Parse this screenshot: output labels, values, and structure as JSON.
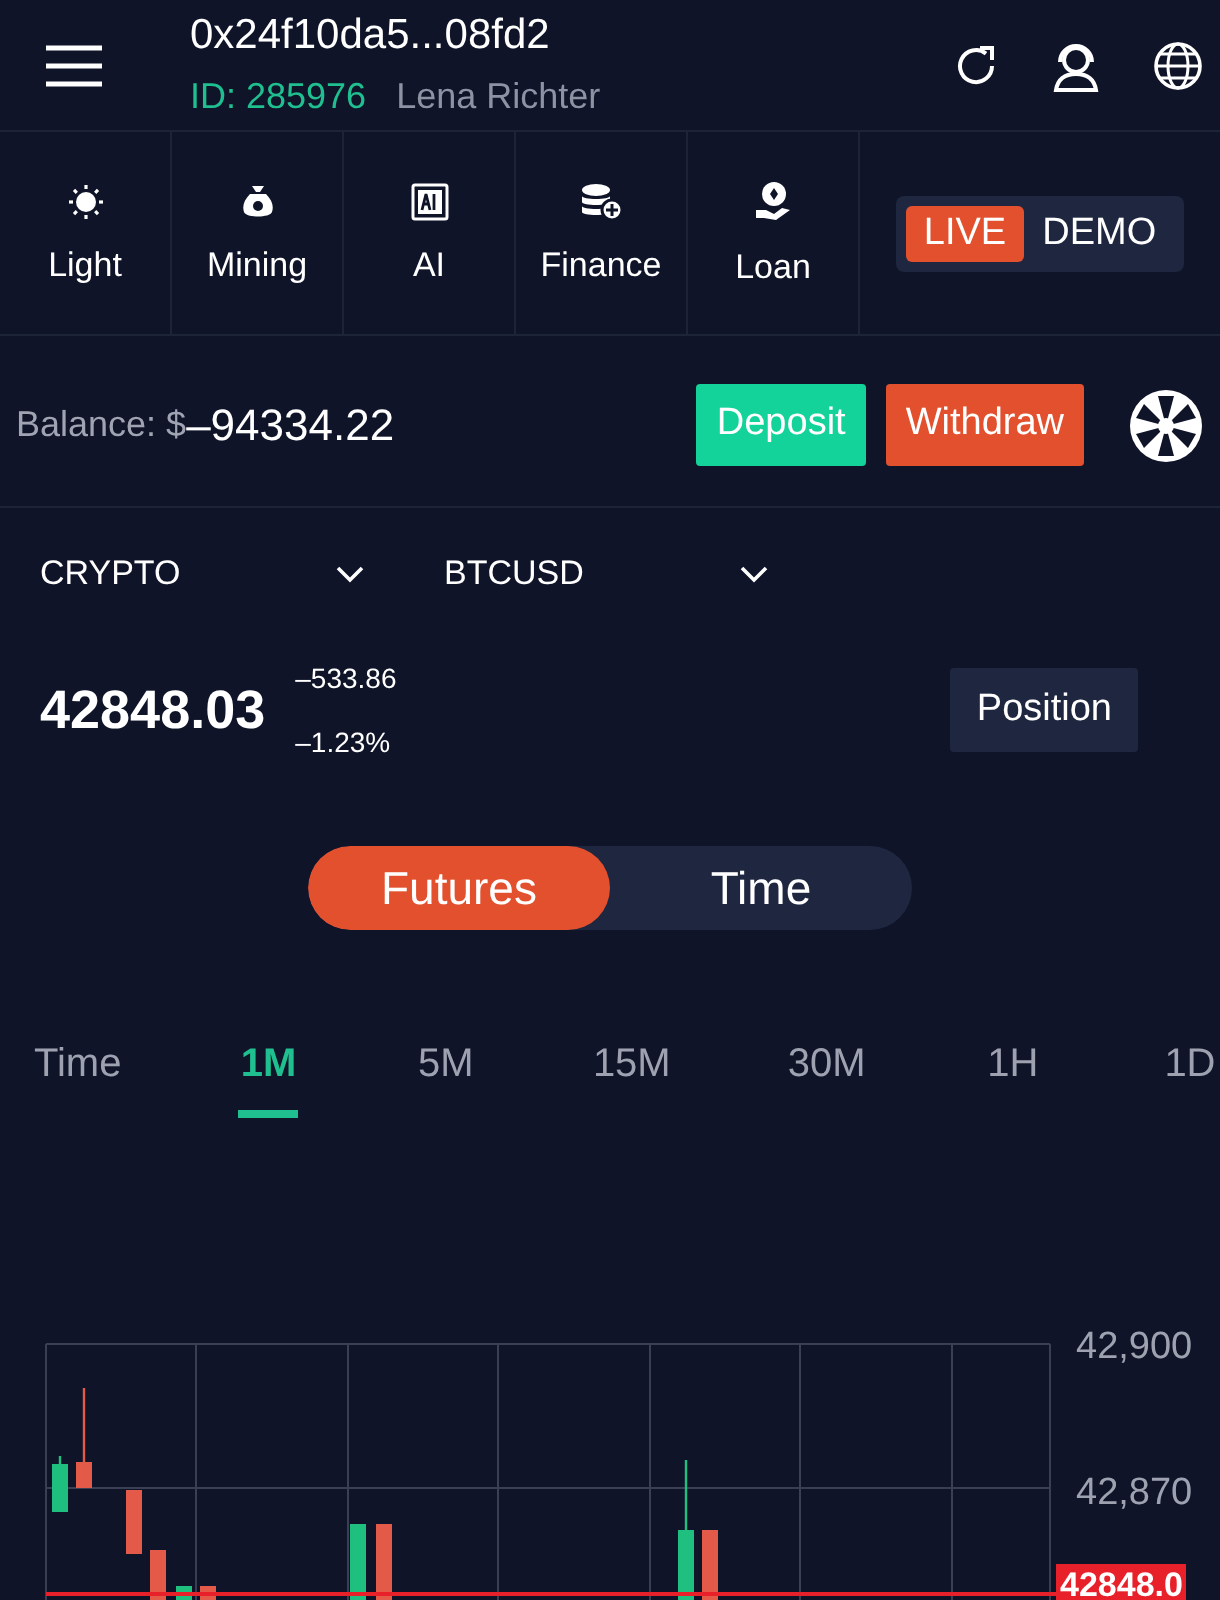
{
  "header": {
    "address": "0x24f10da5...08fd2",
    "user_id": "ID: 285976",
    "user_name": "Lena Richter"
  },
  "shortcuts": [
    {
      "kind": "light",
      "label": "Light"
    },
    {
      "kind": "mining",
      "label": "Mining"
    },
    {
      "kind": "ai",
      "label": "AI"
    },
    {
      "kind": "finance",
      "label": "Finance"
    },
    {
      "kind": "loan",
      "label": "Loan"
    }
  ],
  "mode_switch": [
    {
      "label": "LIVE",
      "selected": true
    },
    {
      "label": "DEMO",
      "selected": false
    }
  ],
  "balance": {
    "label": "Balance: $",
    "value": "–94334.22"
  },
  "actions": [
    {
      "kind": "deposit",
      "label": "Deposit"
    },
    {
      "kind": "withdraw",
      "label": "Withdraw"
    }
  ],
  "selectors": [
    {
      "label": "CRYPTO"
    },
    {
      "label": "BTCUSD"
    }
  ],
  "quote": {
    "price": "42848.03",
    "change": "–533.86",
    "change_percent": "–1.23%",
    "position_button": "Position"
  },
  "trade_type": [
    {
      "label": "Futures",
      "selected": true
    },
    {
      "label": "Time",
      "selected": false
    }
  ],
  "intervals": [
    {
      "label": "Time",
      "selected": false
    },
    {
      "label": "1M",
      "selected": true
    },
    {
      "label": "5M",
      "selected": false
    },
    {
      "label": "15M",
      "selected": false
    },
    {
      "label": "30M",
      "selected": false
    },
    {
      "label": "1H",
      "selected": false
    },
    {
      "label": "1D",
      "selected": false
    }
  ],
  "chart": {
    "y_labels": [
      "42,900",
      "42,870"
    ],
    "price_tag": "42848.0"
  }
}
